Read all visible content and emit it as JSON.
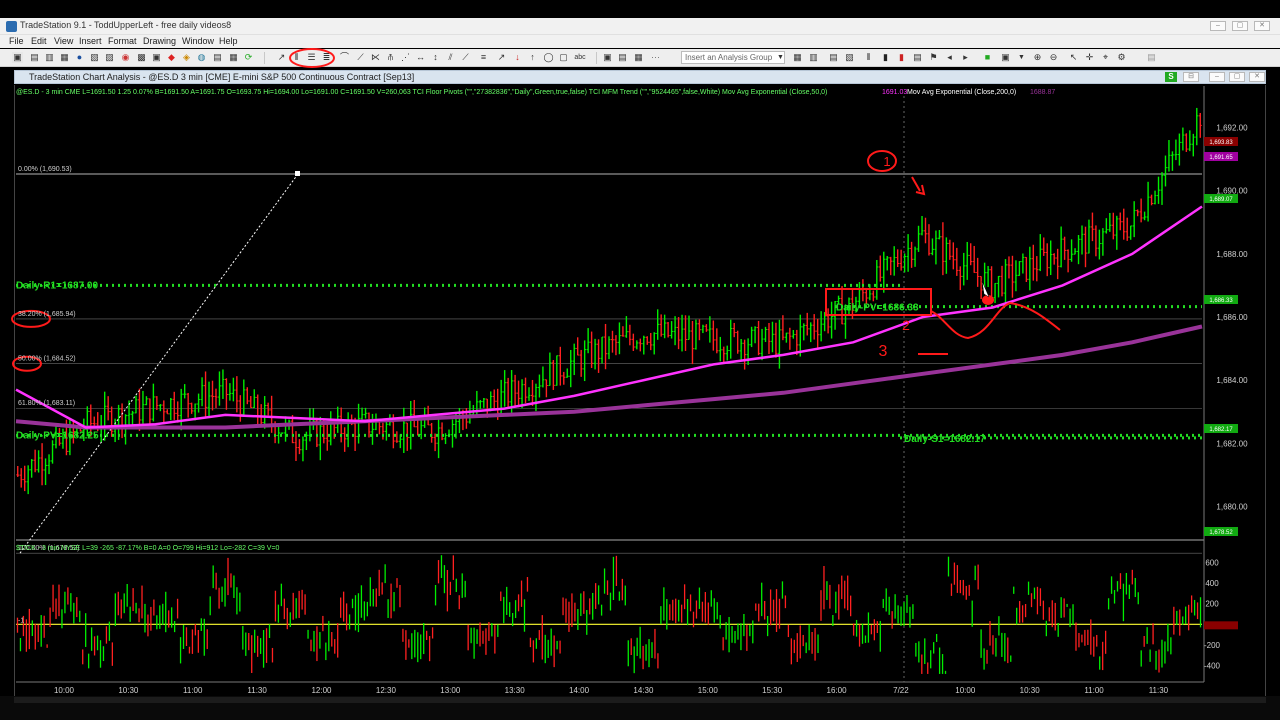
{
  "window": {
    "title": "TradeStation 9.1 - ToddUpperLeft - free daily videos8",
    "controls": [
      "–",
      "▢",
      "✕"
    ]
  },
  "menu": [
    "File",
    "Edit",
    "View",
    "Insert",
    "Format",
    "Drawing",
    "Window",
    "Help"
  ],
  "toolbar": {
    "analysis_group_placeholder": "Insert an Analysis Group"
  },
  "chart_window": {
    "title": "TradeStation Chart Analysis - @ES.D 3 min [CME] E-mini S&P 500 Continuous Contract [Sep13]",
    "s_badge": "S"
  },
  "colors": {
    "up_bar": "#00ee00",
    "down_bar": "#ff2020",
    "ema50": "#ff33ff",
    "ema200": "#993399",
    "pivot_green": "#22dd22",
    "fib_line": "#c8c8c8",
    "annotation_red": "#ff1a1a",
    "breadth_zero": "#ffff33"
  },
  "price_chart": {
    "header": "@ES.D - 3 min  CME  L=1691.50  1.25  0.07%  B=1691.50  A=1691.75  O=1693.75  Hi=1694.00  Lo=1691.00  C=1691.50  V=260,063  TCI Floor Pivots (\"\",\"27382836\",\"Daily\",Green,true,false)   TCI MFM Trend (\"\",\"9524465\",false,White)   Mov Avg Exponential (Close,50,0)",
    "header_ema50_value": "1691.03",
    "header_ema200_label": "Mov Avg Exponential (Close,200,0)",
    "header_ema200_value": "1688.87",
    "y_ticks": [
      "1,692.00",
      "1,690.00",
      "1,688.00",
      "1,686.00",
      "1,684.00",
      "1,682.00",
      "1,680.00"
    ],
    "fib_labels": [
      "0.00% (1,690.53)",
      "38.20% (1,685.94)",
      "50.00% (1,684.52)",
      "61.80% (1,683.11)",
      "100.00% (1,678.52)"
    ],
    "pivot_labels": {
      "r1": "Daily-R1=1687.00",
      "pv_prior": "Daily-PV=1682.25",
      "pv_current": "Daily-PV=1686.33",
      "s1": "Daily-S1=1682.17"
    },
    "right_tags": [
      "1,693.83",
      "1,691.65",
      "1,689.07",
      "1,686.33",
      "1,682.17",
      "1,678.52"
    ]
  },
  "breadth_panel": {
    "header": "$TICK - 3 min  NYSE  L=39  -265  -87.17%  B=0  A=0  O=799  Hi=912  Lo=-282  C=39  V=0",
    "y_ticks": [
      "600",
      "400",
      "200",
      "0",
      "-200",
      "-400"
    ],
    "left_marker": "-1"
  },
  "time_axis": [
    "10:00",
    "10:30",
    "11:00",
    "11:30",
    "12:00",
    "12:30",
    "13:00",
    "13:30",
    "14:00",
    "14:30",
    "15:00",
    "15:30",
    "16:00",
    "7/22",
    "10:00",
    "10:30",
    "11:00",
    "11:30"
  ],
  "annotations": [
    "1",
    "2",
    "3"
  ],
  "chart_data": [
    {
      "type": "line",
      "title": "@ES.D 3 min E-mini S&P 500 Continuous Contract [Sep13]",
      "x_labels": [
        "10:00",
        "10:30",
        "11:00",
        "11:30",
        "12:00",
        "12:30",
        "13:00",
        "13:30",
        "14:00",
        "14:30",
        "15:00",
        "15:30",
        "16:00",
        "7/22",
        "10:00",
        "10:30",
        "11:00",
        "11:30"
      ],
      "ylim": [
        1679,
        1693
      ],
      "series": [
        {
          "name": "Close",
          "values": [
            1681.0,
            1682.6,
            1683.2,
            1683.6,
            1682.2,
            1682.6,
            1682.4,
            1683.5,
            1684.6,
            1685.5,
            1685.3,
            1685.2,
            1686.4,
            1688.6,
            1687.0,
            1688.1,
            1688.9,
            1692.4
          ]
        },
        {
          "name": "Mov Avg Exponential (Close,50,0)",
          "values": [
            1683.7,
            1682.5,
            1682.6,
            1682.9,
            1682.8,
            1682.7,
            1682.9,
            1683.1,
            1683.5,
            1684.0,
            1684.5,
            1684.8,
            1685.2,
            1686.0,
            1686.3,
            1687.0,
            1688.0,
            1689.5
          ]
        },
        {
          "name": "Mov Avg Exponential (Close,200,0)",
          "values": [
            1682.7,
            1682.5,
            1682.5,
            1682.5,
            1682.6,
            1682.7,
            1682.8,
            1682.9,
            1683.0,
            1683.2,
            1683.4,
            1683.6,
            1683.9,
            1684.2,
            1684.5,
            1684.8,
            1685.2,
            1685.7
          ]
        }
      ],
      "horizontal_levels": [
        {
          "name": "Daily-R1",
          "value": 1687.0
        },
        {
          "name": "Daily-PV (prior)",
          "value": 1682.25
        },
        {
          "name": "Daily-PV",
          "value": 1686.33
        },
        {
          "name": "Daily-S1",
          "value": 1682.17
        },
        {
          "name": "Fib 0.00%",
          "value": 1690.53
        },
        {
          "name": "Fib 38.20%",
          "value": 1685.94
        },
        {
          "name": "Fib 50.00%",
          "value": 1684.52
        },
        {
          "name": "Fib 61.80%",
          "value": 1683.11
        },
        {
          "name": "Fib 100.00%",
          "value": 1678.52
        }
      ]
    },
    {
      "type": "bar",
      "title": "$TICK 3 min NYSE",
      "ylim": [
        -500,
        700
      ],
      "series": [
        {
          "name": "$TICK",
          "values": [
            -150,
            220,
            -280,
            300,
            120,
            -180,
            400,
            -240,
            260,
            -200,
            180,
            340,
            -180,
            520,
            -120,
            280,
            -260,
            160,
            380,
            -320,
            220,
            140,
            -140,
            260,
            -260,
            300,
            -100,
            210,
            -380,
            440,
            -210,
            260,
            110,
            -260,
            390,
            -300,
            100
          ]
        }
      ]
    }
  ]
}
